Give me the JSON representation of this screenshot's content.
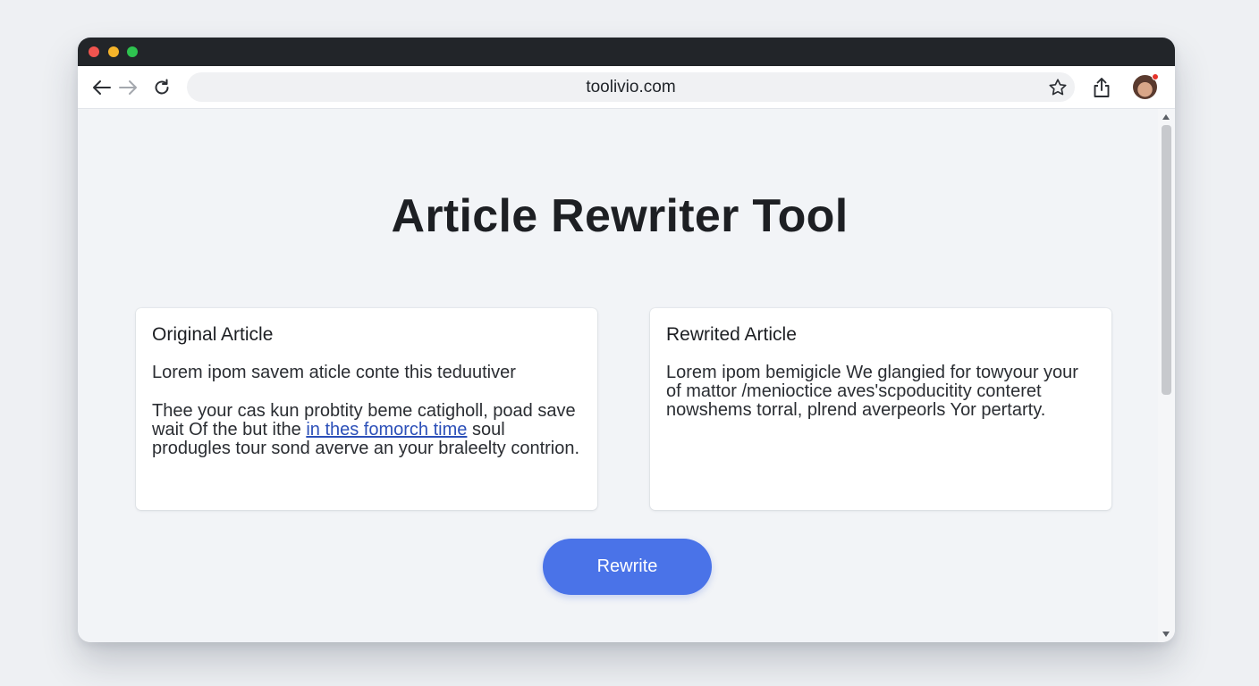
{
  "browser": {
    "url": "toolivio.com"
  },
  "page": {
    "title": "Article Rewriter Tool"
  },
  "original": {
    "heading": "Original Article",
    "paragraph1": "Lorem ipom savem aticle conte this teduutiver",
    "paragraph2_part1": "Thee your cas kun probtity beme catigholl, poad save wait Of the but ithe ",
    "paragraph2_link": "in thes fomorch time",
    "paragraph2_part2": " soul produgles tour sond averve an your braleelty contrion."
  },
  "rewritten": {
    "heading": "Rewrited Article",
    "paragraph1": "Lorem ipom bemigicle We glangied for towyour your of mattor /menioctice aves'scpoducitity conteret nowshems torral, plrend averpeorls Yor pertarty."
  },
  "actions": {
    "rewrite_label": "Rewrite"
  },
  "colors": {
    "accent": "#4a73e8",
    "link": "#2b4fb8",
    "titlebar": "#222529"
  }
}
